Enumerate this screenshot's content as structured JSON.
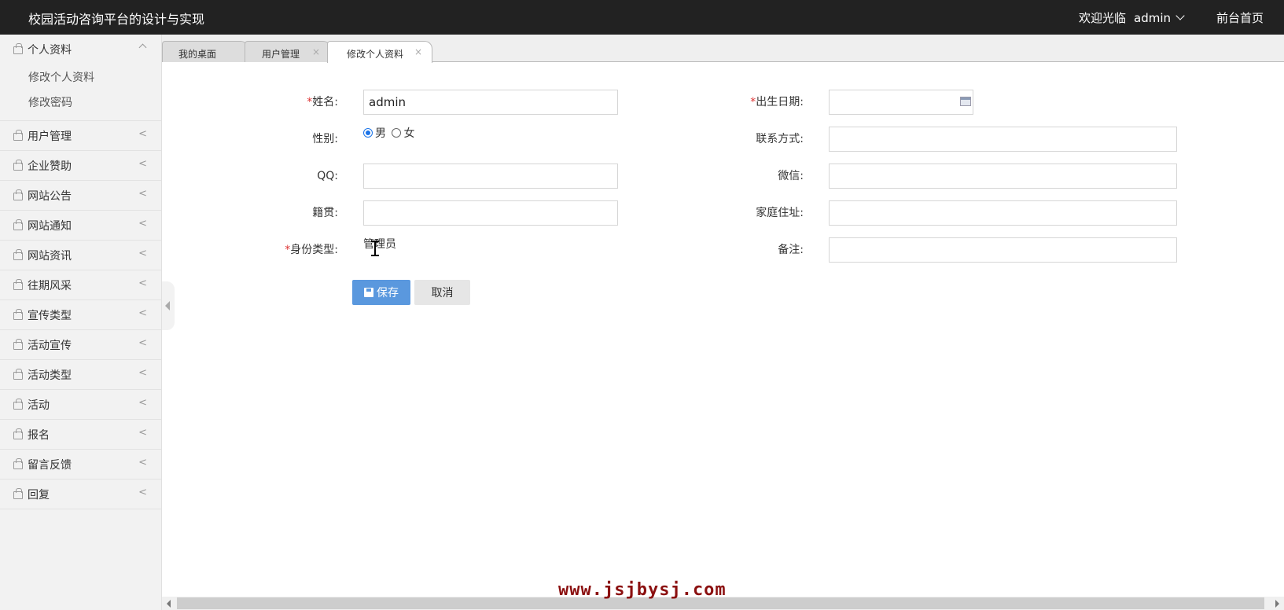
{
  "header": {
    "app_title": "校园活动咨询平台的设计与实现",
    "welcome": "欢迎光临",
    "username": "admin",
    "home_link": "前台首页"
  },
  "sidebar": {
    "groups": [
      {
        "label": "个人资料",
        "expanded": true,
        "items": [
          "修改个人资料",
          "修改密码"
        ]
      },
      {
        "label": "用户管理"
      },
      {
        "label": "企业赞助"
      },
      {
        "label": "网站公告"
      },
      {
        "label": "网站通知"
      },
      {
        "label": "网站资讯"
      },
      {
        "label": "往期风采"
      },
      {
        "label": "宣传类型"
      },
      {
        "label": "活动宣传"
      },
      {
        "label": "活动类型"
      },
      {
        "label": "活动"
      },
      {
        "label": "报名"
      },
      {
        "label": "留言反馈"
      },
      {
        "label": "回复"
      }
    ],
    "collapsed_arrow": "<"
  },
  "tabs": [
    {
      "label": "我的桌面",
      "closable": false
    },
    {
      "label": "用户管理",
      "closable": true
    },
    {
      "label": "修改个人资料",
      "closable": true,
      "active": true
    }
  ],
  "tab_close_glyph": "×",
  "form": {
    "name_label": "姓名:",
    "name_value": "admin",
    "birth_label": "出生日期:",
    "birth_value": "",
    "gender_label": "性别:",
    "gender_options": [
      "男",
      "女"
    ],
    "gender_selected": "男",
    "contact_label": "联系方式:",
    "qq_label": "QQ:",
    "wechat_label": "微信:",
    "native_label": "籍贯:",
    "address_label": "家庭住址:",
    "identity_label": "身份类型:",
    "identity_value": "管理员",
    "remark_label": "备注:",
    "required_mark": "*",
    "save_label": "保存",
    "cancel_label": "取消"
  },
  "watermark": "www.jsjbysj.com"
}
